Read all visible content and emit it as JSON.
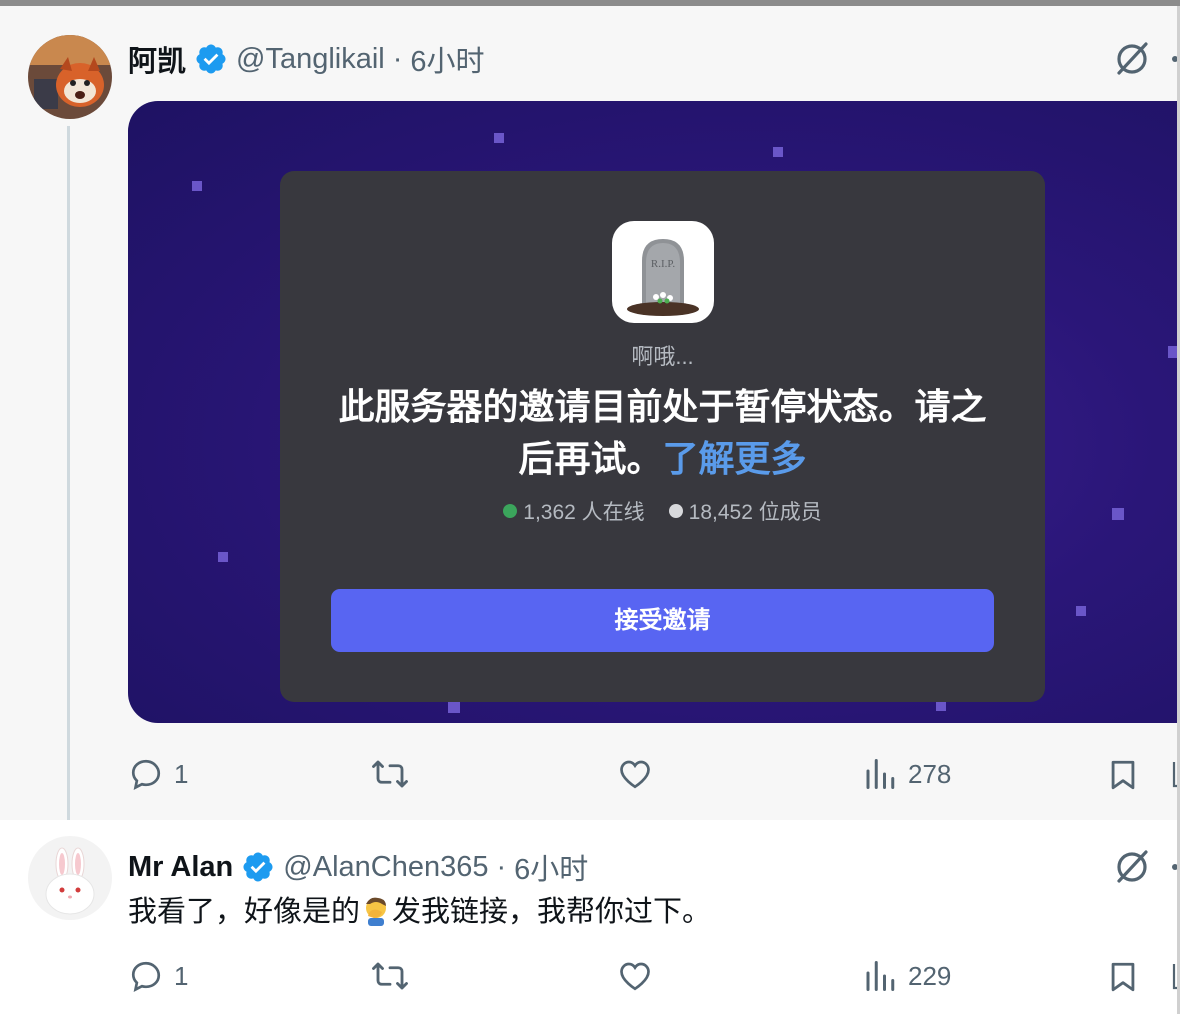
{
  "tweet1": {
    "name": "阿凯",
    "handle": "@Tanglikail",
    "separator": "·",
    "time": "6小时",
    "media": {
      "server_icon_text": "R.I.P.",
      "subtitle": "啊哦...",
      "message_main": "此服务器的邀请目前处于暂停状态。请之后再试。",
      "learn_more": "了解更多",
      "online": "1,362 人在线",
      "members": "18,452 位成员",
      "online_color": "#3ba55c",
      "members_color": "#b5bac1",
      "accept_button": "接受邀请"
    },
    "actions": {
      "replies": "1",
      "views": "278"
    }
  },
  "tweet2": {
    "name": "Mr Alan",
    "handle": "@AlanChen365",
    "separator": "·",
    "time": "6小时",
    "text_before_emoji": "我看了，好像是的",
    "emoji": "facepalm-emoji",
    "text_after_emoji": "发我链接，我帮你过下。",
    "actions": {
      "replies": "1",
      "views": "229"
    }
  },
  "colors": {
    "verified": "#1d9bf0",
    "accent": "#5865f2",
    "link": "#5a9bea"
  }
}
